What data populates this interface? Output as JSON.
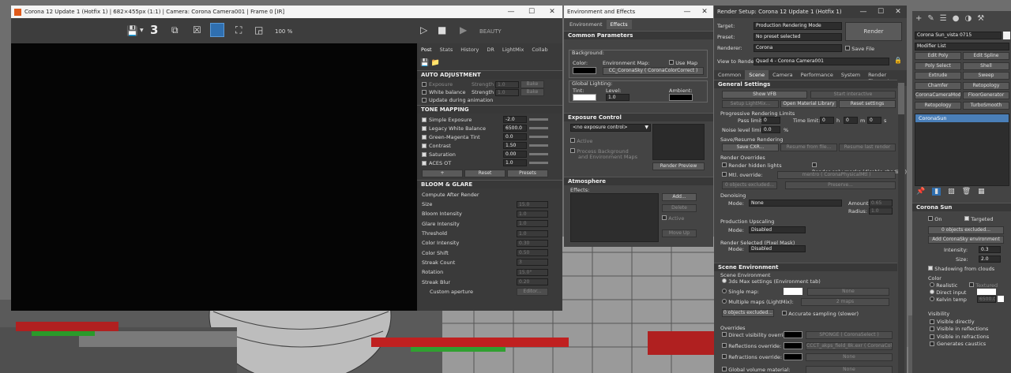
{
  "vfb": {
    "title": "Corona 12 Update 1 (Hotfix 1) | 682×455px (1:1) | Camera: Corona Camera001 | Frame 0 [IR]",
    "channel_number": "3",
    "zoom": "100 %",
    "beauty": "BEAUTY",
    "tabs": [
      "Post",
      "Stats",
      "History",
      "DR",
      "LightMix",
      "Collab"
    ],
    "auto_adjust": {
      "header": "AUTO ADJUSTMENT",
      "rows": [
        {
          "label": "Exposure",
          "strength_label": "Strength",
          "value": "1.0",
          "bake": "Bake"
        },
        {
          "label": "White balance",
          "strength_label": "Strength",
          "value": "1.0",
          "bake": "Bake"
        }
      ],
      "update": "Update during animation"
    },
    "tone": {
      "header": "TONE MAPPING",
      "rows": [
        {
          "label": "Simple Exposure",
          "value": "-2.0"
        },
        {
          "label": "Legacy White Balance",
          "value": "6500.0"
        },
        {
          "label": "Green-Magenta Tint",
          "value": "0.0"
        },
        {
          "label": "Contrast",
          "value": "1.50"
        },
        {
          "label": "Saturation",
          "value": "0.00"
        },
        {
          "label": "ACES OT",
          "value": "1.0"
        }
      ],
      "plus": "+",
      "reset": "Reset",
      "presets": "Presets"
    },
    "bloom": {
      "header": "BLOOM & GLARE",
      "compute": "Compute After Render",
      "rows": [
        {
          "label": "Size",
          "value": "15.0"
        },
        {
          "label": "Bloom Intensity",
          "value": "1.0"
        },
        {
          "label": "Glare Intensity",
          "value": "1.0"
        },
        {
          "label": "Threshold",
          "value": "1.0"
        },
        {
          "label": "Color Intensity",
          "value": "0.30"
        },
        {
          "label": "Color Shift",
          "value": "0.50"
        },
        {
          "label": "Streak Count",
          "value": "3"
        },
        {
          "label": "Rotation",
          "value": "15.0°"
        },
        {
          "label": "Streak Blur",
          "value": "0.20"
        }
      ],
      "custom": "Custom aperture",
      "editor": "Editor..."
    }
  },
  "env": {
    "title": "Environment and Effects",
    "tabs": [
      "Environment",
      "Effects"
    ],
    "common": "Common Parameters",
    "background": "Background:",
    "color_label": "Color:",
    "env_map": "Environment Map:",
    "use_map": "Use Map",
    "map_btn": "CC_CoronaSky  ( CoronaColorCorrect )",
    "global_lighting": "Global Lighting:",
    "tint": "Tint:",
    "level": "Level:",
    "level_val": "1.0",
    "ambient": "Ambient:",
    "exposure": "Exposure Control",
    "no_exposure": "<no exposure control>",
    "active": "Active",
    "process_bg": "Process Background",
    "and_env": "and Environment Maps",
    "render_preview": "Render Preview",
    "atmosphere": "Atmosphere",
    "effects": "Effects:",
    "add": "Add...",
    "delete": "Delete",
    "active2": "Active",
    "move_up": "Move Up"
  },
  "rs": {
    "title": "Render Setup: Corona 12 Update 1 (Hotfix 1)",
    "target_label": "Target:",
    "target": "Production Rendering Mode",
    "preset_label": "Preset:",
    "preset": "No preset selected",
    "renderer_label": "Renderer:",
    "renderer": "Corona",
    "save_file": "Save File",
    "render": "Render",
    "view_label": "View to Render:",
    "view": "Quad 4 - Corona Camera001",
    "tabs": [
      "Common",
      "Scene",
      "Camera",
      "Performance",
      "System",
      "Render Elements"
    ],
    "general": "General Settings",
    "show_vfb": "Show VFB",
    "start_interactive": "Start interactive",
    "setup_lightmix": "Setup LightMix...",
    "open_mat": "Open Material Library",
    "reset": "Reset settings",
    "prog": "Progressive Rendering Limits",
    "pass_limit": "Pass limit:",
    "pass_val": "0",
    "time_limit": "Time limit:",
    "t0": "0",
    "h": "h",
    "m": "m",
    "s": "s",
    "noise": "Noise level limit:",
    "noise_val": "0.0",
    "pct": "%",
    "save_resume": "Save/Resume Rendering",
    "save_cxr": "Save CXR...",
    "resume_file": "Resume from file...",
    "resume_last": "Resume last render",
    "overrides": "Render Overrides",
    "hidden_lights": "Render hidden lights",
    "only_masks": "Render only masks (disable shading)",
    "mtl_override": "Mtl. override:",
    "mtl_val": "mentro  ( CoronaPhysicalMtl )",
    "objects_excluded": "0 objects excluded...",
    "preserve": "Preserve...",
    "denoising": "Denoising",
    "mode_label": "Mode:",
    "none": "None",
    "amount": "Amount:",
    "amount_val": "0.65",
    "radius": "Radius:",
    "radius_val": "1.0",
    "upscaling": "Production Upscaling",
    "disabled": "Disabled",
    "selected": "Render Selected (Pixel Mask)",
    "scene_env": "Scene Environment",
    "scene_env_sub": "Scene Environment",
    "max_settings": "3ds Max settings (Environment tab)",
    "single_map": "Single map:",
    "multi_maps": "Multiple maps (LightMix):",
    "two_maps": "2 maps",
    "accurate": "Accurate sampling (slower)",
    "overrides2": "Overrides",
    "direct_vis": "Direct visibility override:",
    "sponge": "SPONGE  ( CoronaSelect )",
    "refl": "Reflections override:",
    "refl_val": "CCCT_akps_field_8k.exr  ( CoronaColo",
    "refr": "Refractions override:",
    "gvm": "Global volume material:"
  },
  "cmd": {
    "name": "Corona Sun_vista 0715",
    "mod_list": "Modifier List",
    "buttons": [
      [
        "Edit Poly",
        "Edit Spline"
      ],
      [
        "Poly Select",
        "Shell"
      ],
      [
        "Extrude",
        "Sweep"
      ],
      [
        "Chamfer",
        "Retopology"
      ],
      [
        "CoronaCameraMod",
        "FloorGenerator"
      ],
      [
        "Retopology",
        "TurboSmooth"
      ]
    ],
    "stack_item": "CoronaSun",
    "rollout": "Corona Sun",
    "on": "On",
    "targeted": "Targeted",
    "objects_excluded": "0 objects excluded...",
    "add_sky": "Add CoronaSky environment",
    "intensity": "Intensity:",
    "intensity_val": "0.3",
    "size": "Size:",
    "size_val": "2.0",
    "shadowing": "Shadowing from clouds",
    "color": "Color",
    "realistic": "Realistic",
    "textured": "Textured",
    "direct": "Direct input",
    "kelvin": "Kelvin temp",
    "kelvin_val": "6500.0",
    "visibility": "Visibility",
    "vis_items": [
      "Visible directly",
      "Visible in reflections",
      "Visible in refractions",
      "Generates caustics"
    ]
  }
}
